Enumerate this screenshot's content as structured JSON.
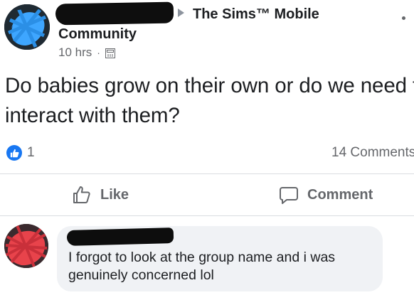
{
  "post": {
    "group_name": "The Sims™ Mobile",
    "group_name_line2": "Community",
    "time": "10 hrs",
    "separator": "·",
    "text": "Do babies grow on their own or do we need to interact with them?",
    "privacy_icon": "group-icon"
  },
  "reactions": {
    "like_count": "1",
    "comment_count": "14 Comments",
    "like_color": "#1877f2"
  },
  "actions": {
    "like_label": "Like",
    "comment_label": "Comment"
  },
  "comment": {
    "text": "I forgot to look at the group name and i was genuinely concerned lol"
  },
  "colors": {
    "text": "#1c1e21",
    "secondary": "#65676b",
    "bubble": "#f0f2f5",
    "divider": "#dadde1",
    "accent": "#1877f2",
    "scribble_blue": "#3ea6ff",
    "scribble_red": "#e8434b"
  }
}
